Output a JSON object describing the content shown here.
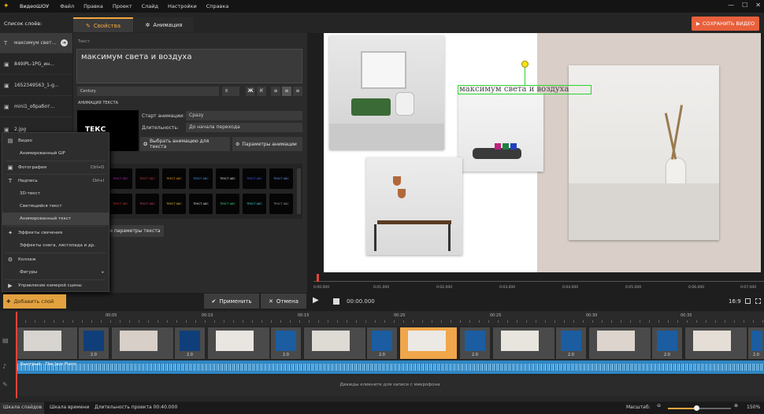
{
  "app": {
    "name": "ВидеоШОУ",
    "menu": [
      "Файл",
      "Правка",
      "Проект",
      "Слайд",
      "Настройки",
      "Справка"
    ]
  },
  "window_controls": [
    "—",
    "☐",
    "✕"
  ],
  "layers": {
    "title": "Список слоёв:",
    "items": [
      {
        "icon": "T",
        "label": "максимум свет...",
        "active": true
      },
      {
        "icon": "▣",
        "label": "849IPL-1PG_ин...",
        "active": false
      },
      {
        "icon": "▣",
        "label": "1652349563_1-g...",
        "active": false
      },
      {
        "icon": "▣",
        "label": "mini1_обработ...",
        "active": false
      },
      {
        "icon": "▣",
        "label": "2.jpg",
        "active": false
      }
    ]
  },
  "tabs": {
    "properties": "Свойства",
    "animation": "Анимация"
  },
  "save_button": "СОХРАНИТЬ ВИДЕО",
  "properties": {
    "text_label": "Текст",
    "text_value": "максимум света и воздуха",
    "font": "Century",
    "font_size": "8",
    "anim_text_label": "АНИМАЦИЯ ТЕКСТА",
    "preview_text": "ТЕКС",
    "anim_start_label": "Старт анимации:",
    "anim_start_value": "Сразу",
    "duration_label": "Длительность:",
    "duration_value": "До начала перехода",
    "choose_anim_button": "Выбрать анимацию для текста",
    "anim_params_button": "Параметры анимации",
    "more_params_button": "Все параметры текста",
    "preset_label": "ТЕКСТ АБС"
  },
  "popup_menu": [
    {
      "icon": "🎬",
      "label": "Видео",
      "shortcut": "",
      "sub": false,
      "hl": false
    },
    {
      "icon": "",
      "label": "Анимированный GIF",
      "shortcut": "",
      "sub": true,
      "hl": false
    },
    {
      "icon": "▣",
      "label": "Фотография",
      "shortcut": "Ctrl+O",
      "sub": false,
      "hl": false
    },
    {
      "icon": "T",
      "label": "Надпись",
      "shortcut": "Ctrl+I",
      "sub": false,
      "hl": false
    },
    {
      "icon": "",
      "label": "3D-текст",
      "shortcut": "",
      "sub": true,
      "hl": false
    },
    {
      "icon": "",
      "label": "Светящийся текст",
      "shortcut": "",
      "sub": true,
      "hl": false
    },
    {
      "icon": "",
      "label": "Анимированный текст",
      "shortcut": "",
      "sub": true,
      "hl": true
    },
    {
      "icon": "✦",
      "label": "Эффекты свечения",
      "shortcut": "",
      "sub": false,
      "hl": false
    },
    {
      "icon": "",
      "label": "Эффекты снега, листопада и др.",
      "shortcut": "",
      "sub": true,
      "hl": false
    },
    {
      "icon": "⚙",
      "label": "Коллаж",
      "shortcut": "",
      "sub": false,
      "hl": false
    },
    {
      "icon": "",
      "label": "Фигуры",
      "shortcut": "▸",
      "sub": true,
      "hl": false
    },
    {
      "icon": "🎥",
      "label": "Управление камерой сцены",
      "shortcut": "",
      "sub": false,
      "hl": false
    }
  ],
  "add_layer_button": "Добавить слой",
  "apply_button": "Применить",
  "cancel_button": "Отмена",
  "canvas": {
    "overlay_text": "максимум света и воздуха"
  },
  "preview_scale": [
    "0:00.000",
    "0:01.000",
    "0:02.000",
    "0:03.000",
    "0:04.000",
    "0:05.000",
    "0:06.000",
    "0:07.000"
  ],
  "transport": {
    "timecode": "00:00.000",
    "ratio": "16:9"
  },
  "ruler": [
    "00:05",
    "00:10",
    "00:15",
    "00:20",
    "00:25",
    "00:30",
    "00:35"
  ],
  "clips": [
    {
      "duration": "",
      "color": "#d8d4cf"
    },
    {
      "duration": "2.0",
      "color": "#0f3e78"
    },
    {
      "duration": "",
      "color": "#d7cfc8"
    },
    {
      "duration": "2.0",
      "color": "#0f3e78"
    },
    {
      "duration": "",
      "color": "#e9e5e0"
    },
    {
      "duration": "2.0",
      "color": "#1b5da0"
    },
    {
      "duration": "",
      "color": "#dedad4"
    },
    {
      "duration": "2.0",
      "color": "#1b5da0"
    },
    {
      "duration": "",
      "color": "#ece9e4"
    },
    {
      "duration": "2.0",
      "color": "#1b5da0"
    },
    {
      "duration": "",
      "color": "#e8e4de"
    },
    {
      "duration": "2.0",
      "color": "#1b5da0"
    },
    {
      "duration": "",
      "color": "#ddd5cd"
    },
    {
      "duration": "2.0",
      "color": "#1b5da0"
    },
    {
      "duration": "",
      "color": "#e4ded6"
    },
    {
      "duration": "2.0",
      "color": "#1b5da0"
    }
  ],
  "audio_track": "Быстрый - The Jazz Piano",
  "mic_hint": "Дважды кликните для записи с микрофона",
  "status": {
    "tab_slides": "Шкала слайдов",
    "tab_timeline": "Шкала времени",
    "duration": "Длительность проекта 00:40.000",
    "zoom_label": "Масштаб:",
    "zoom_value": "150%",
    "zoom_fraction": 0.45
  },
  "colors": {
    "accent": "#f4a640",
    "save": "#e8603c",
    "selection": "#2fd32f",
    "audio": "#2f86c2"
  }
}
